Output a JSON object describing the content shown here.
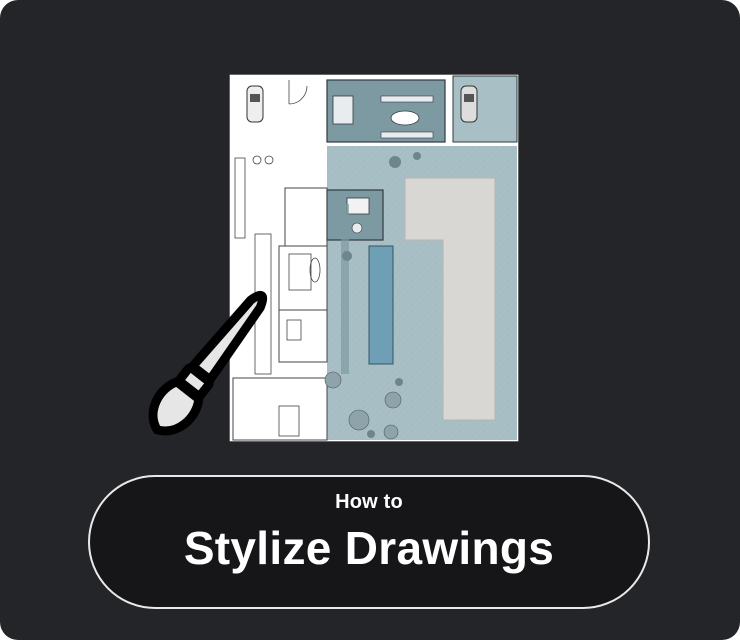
{
  "card": {
    "kicker": "How to",
    "title": "Stylize Drawings"
  },
  "illustration": {
    "subject": "floor-plan",
    "icon": "paintbrush-icon"
  },
  "colors": {
    "background": "#232529",
    "pill": "#161618",
    "pill_border": "#e9e9e9",
    "text": "#ffffff",
    "plan_teal": "#7d9aa3",
    "plan_pool": "#6f9fb5",
    "plan_ground": "#a9bfc6",
    "plan_paving": "#d9d7d3"
  }
}
